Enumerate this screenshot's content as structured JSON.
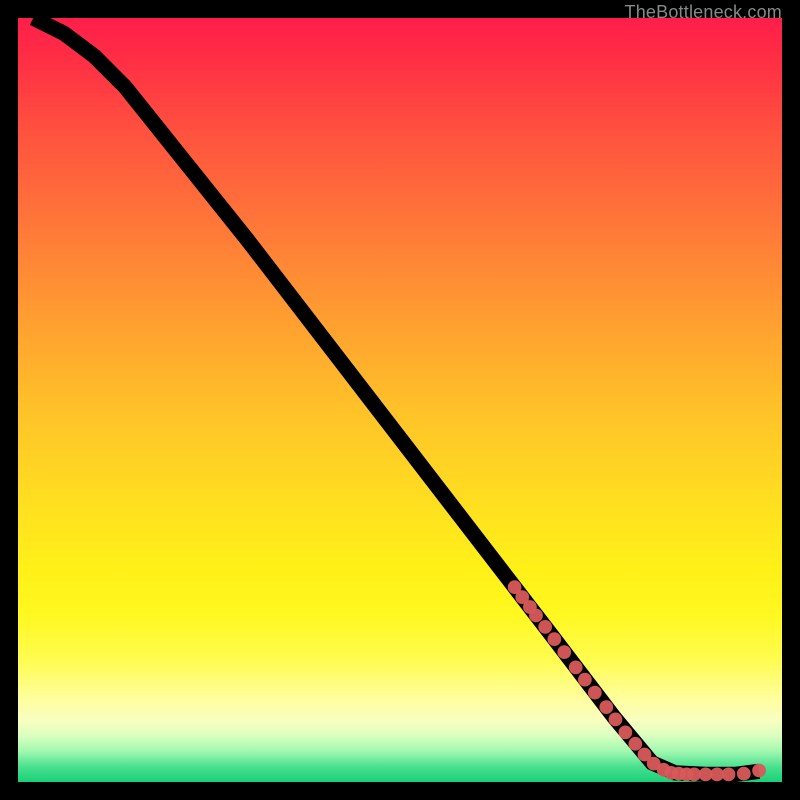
{
  "watermark": "TheBottleneck.com",
  "chart_data": {
    "type": "line",
    "title": "",
    "xlabel": "",
    "ylabel": "",
    "xlim": [
      0,
      100
    ],
    "ylim": [
      0,
      100
    ],
    "grid": false,
    "curve": [
      {
        "x": 2,
        "y": 100
      },
      {
        "x": 6,
        "y": 98
      },
      {
        "x": 10,
        "y": 95
      },
      {
        "x": 14,
        "y": 91
      },
      {
        "x": 18,
        "y": 86
      },
      {
        "x": 24,
        "y": 78.5
      },
      {
        "x": 30,
        "y": 71
      },
      {
        "x": 40,
        "y": 58
      },
      {
        "x": 50,
        "y": 45
      },
      {
        "x": 60,
        "y": 32
      },
      {
        "x": 70,
        "y": 19
      },
      {
        "x": 78,
        "y": 8.5
      },
      {
        "x": 83,
        "y": 2.5
      },
      {
        "x": 86,
        "y": 1.2
      },
      {
        "x": 90,
        "y": 1.0
      },
      {
        "x": 94,
        "y": 1.0
      },
      {
        "x": 97,
        "y": 1.4
      }
    ],
    "scatter": [
      {
        "x": 65,
        "y": 25.5
      },
      {
        "x": 66,
        "y": 24.2
      },
      {
        "x": 67,
        "y": 22.9
      },
      {
        "x": 67.8,
        "y": 21.8
      },
      {
        "x": 69,
        "y": 20.3
      },
      {
        "x": 70.2,
        "y": 18.7
      },
      {
        "x": 71.5,
        "y": 17
      },
      {
        "x": 73,
        "y": 15
      },
      {
        "x": 74.2,
        "y": 13.4
      },
      {
        "x": 75.5,
        "y": 11.7
      },
      {
        "x": 77,
        "y": 9.8
      },
      {
        "x": 78.2,
        "y": 8.2
      },
      {
        "x": 79.5,
        "y": 6.5
      },
      {
        "x": 80.8,
        "y": 5
      },
      {
        "x": 82,
        "y": 3.6
      },
      {
        "x": 83.2,
        "y": 2.4
      },
      {
        "x": 84.5,
        "y": 1.6
      },
      {
        "x": 85.5,
        "y": 1.2
      },
      {
        "x": 86.5,
        "y": 1.1
      },
      {
        "x": 87.5,
        "y": 1.0
      },
      {
        "x": 88.5,
        "y": 1.0
      },
      {
        "x": 90,
        "y": 1.0
      },
      {
        "x": 91.5,
        "y": 1.0
      },
      {
        "x": 93,
        "y": 1.0
      },
      {
        "x": 95,
        "y": 1.1
      },
      {
        "x": 97,
        "y": 1.5
      }
    ],
    "colors": {
      "curve": "#000000",
      "dots": "#d85a5a",
      "gradient_top": "#ff1e4a",
      "gradient_mid": "#fff018",
      "gradient_bottom": "#18d078"
    }
  }
}
